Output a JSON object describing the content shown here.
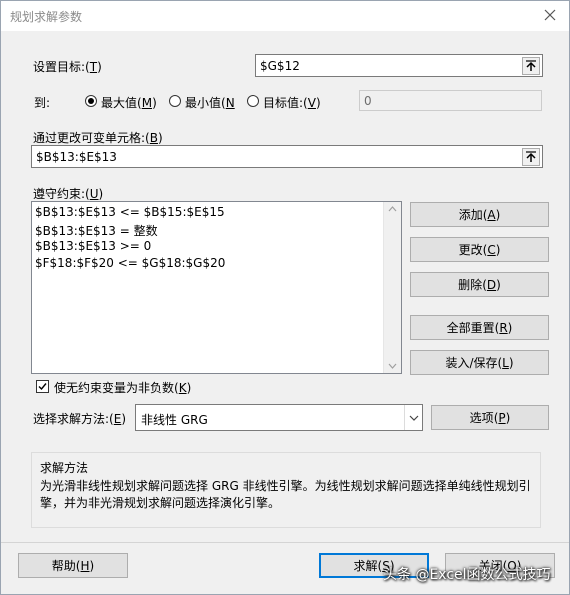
{
  "window": {
    "title": "规划求解参数",
    "close_glyph": "✕"
  },
  "objective": {
    "label_text": "设置目标:",
    "label_key": "T",
    "value": "$G$12"
  },
  "to": {
    "label": "到:",
    "options": [
      {
        "text": "最大值",
        "key": "M",
        "selected": true
      },
      {
        "text": "最小值",
        "key": "N",
        "selected": false
      },
      {
        "text": "目标值:",
        "key": "V",
        "selected": false
      }
    ],
    "target_value": "0"
  },
  "changing_cells": {
    "label_text": "通过更改可变单元格:",
    "label_key": "B",
    "value": "$B$13:$E$13"
  },
  "constraints": {
    "label_text": "遵守约束:",
    "label_key": "U",
    "items": [
      "$B$13:$E$13 <= $B$15:$E$15",
      "$B$13:$E$13 = 整数",
      "$B$13:$E$13 >= 0",
      "$F$18:$F$20 <= $G$18:$G$20"
    ],
    "buttons": [
      {
        "text": "添加",
        "key": "A"
      },
      {
        "text": "更改",
        "key": "C"
      },
      {
        "text": "删除",
        "key": "D"
      },
      {
        "text": "全部重置",
        "key": "R"
      },
      {
        "text": "装入/保存",
        "key": "L"
      }
    ]
  },
  "nonnegative": {
    "text": "使无约束变量为非负数",
    "key": "K",
    "checked": true
  },
  "method": {
    "label_text": "选择求解方法:",
    "label_key": "E",
    "selected": "非线性 GRG",
    "options_button": {
      "text": "选项",
      "key": "P"
    }
  },
  "info": {
    "heading": "求解方法",
    "lines": [
      "为光滑非线性规划求解问题选择 GRG 非线性引擎。为线性规划求解问题选择单纯线性规划引",
      "擎，并为非光滑规划求解问题选择演化引擎。"
    ]
  },
  "footer": {
    "help": {
      "text": "帮助",
      "key": "H"
    },
    "solve": {
      "text": "求解",
      "key": "S"
    },
    "close": {
      "text": "关闭",
      "key": "O"
    }
  },
  "watermark": "头条 @Excel函数公式技巧"
}
